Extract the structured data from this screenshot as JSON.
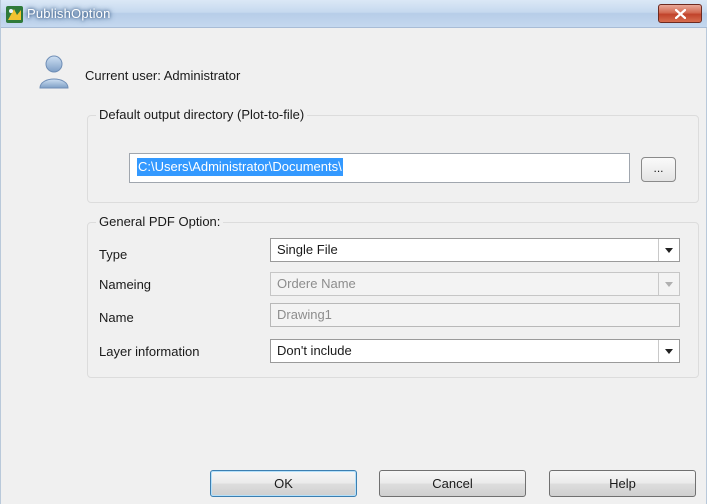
{
  "window": {
    "title": "PublishOption",
    "app_icon": "publish-app-icon",
    "close_icon": "close-icon"
  },
  "user": {
    "icon": "user-icon",
    "label": "Current user: Administrator"
  },
  "output": {
    "legend": "Default output directory (Plot-to-file)",
    "path": "C:\\Users\\Administrator\\Documents\\",
    "browse_label": "..."
  },
  "pdf": {
    "legend": "General PDF Option:",
    "type": {
      "label": "Type",
      "value": "Single File"
    },
    "naming": {
      "label": "Nameing",
      "value": "Ordere Name"
    },
    "name": {
      "label": "Name",
      "value": "Drawing1"
    },
    "layer": {
      "label": "Layer information",
      "value": "Don't include"
    }
  },
  "buttons": {
    "ok": "OK",
    "cancel": "Cancel",
    "help": "Help"
  },
  "colors": {
    "selection": "#3399ff",
    "close_button": "#c1432b",
    "titlebar": "#c6d9ef"
  }
}
